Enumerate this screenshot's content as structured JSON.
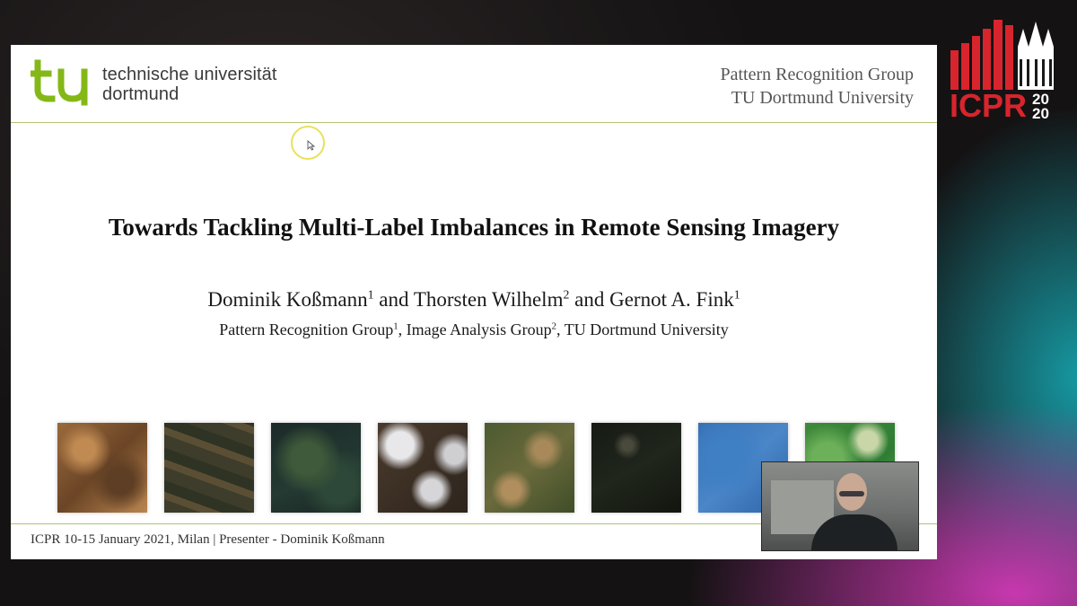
{
  "slide": {
    "logo": {
      "line1": "technische universität",
      "line2": "dortmund",
      "mark_color": "#84b817"
    },
    "group_info": {
      "line1": "Pattern Recognition Group",
      "line2": "TU Dortmund University"
    },
    "title": "Towards Tackling Multi-Label Imbalances in Remote Sensing Imagery",
    "authors": [
      {
        "name": "Dominik Koßmann",
        "sup": "1",
        "sep": " and "
      },
      {
        "name": "Thorsten Wilhelm",
        "sup": "2",
        "sep": " and "
      },
      {
        "name": "Gernot A. Fink",
        "sup": "1",
        "sep": ""
      }
    ],
    "affiliations": [
      {
        "name": "Pattern Recognition Group",
        "sup": "1",
        "sep": ", "
      },
      {
        "name": "Image Analysis Group",
        "sup": "2",
        "sep": ", "
      },
      {
        "name": "TU Dortmund University",
        "sup": "",
        "sep": ""
      }
    ],
    "footer": "ICPR 10-15 January 2021, Milan | Presenter - Dominik Koßmann",
    "accent_line_color": "#b3c473"
  },
  "conference_logo": {
    "text": "ICPR",
    "year_top": "20",
    "year_bottom": "20",
    "color": "#d8242c"
  }
}
